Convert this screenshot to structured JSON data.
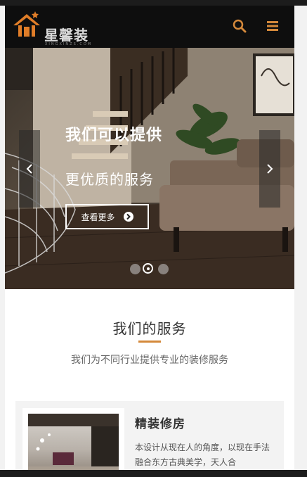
{
  "header": {
    "logo_text": "星馨装潢",
    "logo_subtext": "XINGXINZS.COM",
    "icons": {
      "search": "search-icon",
      "menu": "menu-icon"
    },
    "accent_color": "#d4893b"
  },
  "hero": {
    "title": "我们可以提供",
    "subtitle": "更优质的服务",
    "button_label": "查看更多",
    "prev_icon": "chevron-left-icon",
    "next_icon": "chevron-right-icon",
    "slides_total": 3,
    "active_slide": 2
  },
  "services": {
    "title": "我们的服务",
    "subtitle": "我们为不同行业提供专业的装修服务",
    "items": [
      {
        "title": "精装修房",
        "description": "本设计从现在人的角度，以现在手法融合东方古典美学，天人合"
      }
    ]
  }
}
